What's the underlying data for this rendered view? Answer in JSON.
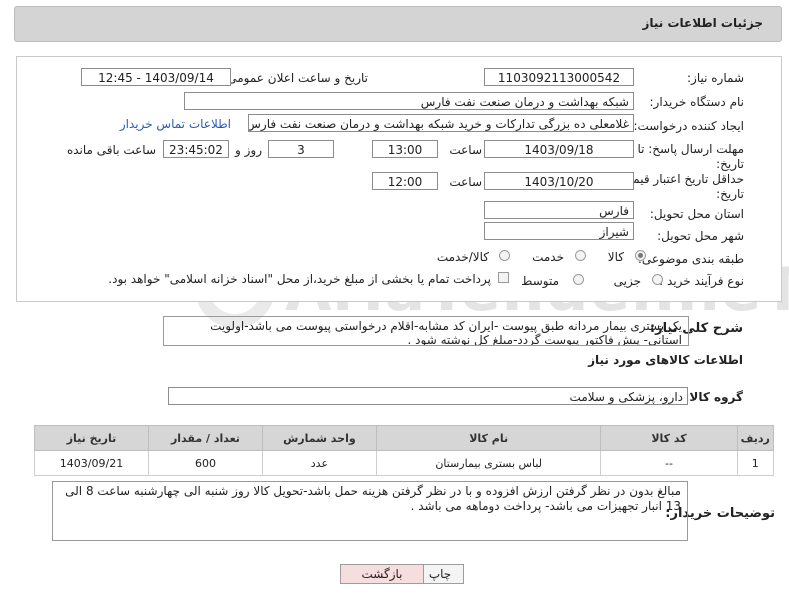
{
  "header": {
    "title": "جزئیات اطلاعات نیاز"
  },
  "form": {
    "need_number": {
      "label": "شماره نیاز:",
      "value": "1103092113000542"
    },
    "announce_datetime": {
      "label": "تاریخ و ساعت اعلان عمومی:",
      "value": "1403/09/14 - 12:45"
    },
    "buyer_org": {
      "label": "نام دستگاه خریدار:",
      "value": "شبکه بهداشت و درمان صنعت نفت فارس"
    },
    "requester": {
      "label": "ایجاد کننده درخواست:",
      "value": "غلامعلی ده بزرگی تدارکات و خرید شبکه بهداشت و درمان صنعت نفت فارس",
      "contact_link": "اطلاعات تماس خریدار"
    },
    "reply_deadline": {
      "label": "مهلت ارسال پاسخ: تا تاریخ:",
      "date": "1403/09/18",
      "time_label": "ساعت",
      "time": "13:00",
      "days": "3",
      "days_label": "روز و",
      "remaining": "23:45:02",
      "remaining_label": "ساعت باقی مانده"
    },
    "price_validity": {
      "label": "حداقل تاریخ اعتبار قیمت: تا تاریخ:",
      "date": "1403/10/20",
      "time_label": "ساعت",
      "time": "12:00"
    },
    "province": {
      "label": "استان محل تحویل:",
      "value": "فارس"
    },
    "city": {
      "label": "شهر محل تحویل:",
      "value": "شیراز"
    },
    "category": {
      "label": "طبقه بندی موضوعی:",
      "options": [
        "کالا",
        "خدمت",
        "کالا/خدمت"
      ]
    },
    "process_type": {
      "label": "نوع فرآیند خرید :",
      "options": [
        "جزیی",
        "متوسط"
      ],
      "payment_note": "پرداخت تمام یا بخشی از مبلغ خرید،از محل \"اسناد خزانه اسلامی\" خواهد بود."
    }
  },
  "description": {
    "label": "شرح کلی نیاز:",
    "text": "یک بستری بیمار مردانه طبق پیوست -ایران کد مشابه-اقلام درخواستی پیوست می باشد-اولویت استانی- پیش فاکتور پیوست گردد-مبلغ کل نوشته شود ."
  },
  "goods_section": {
    "title": "اطلاعات کالاهای مورد نیاز",
    "group_label": "گروه کالا:",
    "group_value": "دارو، پزشکی و سلامت"
  },
  "table": {
    "headers": [
      "ردیف",
      "کد کالا",
      "نام کالا",
      "واحد شمارش",
      "تعداد / مقدار",
      "تاریخ نیاز"
    ],
    "rows": [
      [
        "1",
        "--",
        "لباس بستری بیمارستان",
        "عدد",
        "600",
        "1403/09/21"
      ]
    ]
  },
  "buyer_notes": {
    "label": "توضیحات خریدار:",
    "text": "مبالغ بدون در نظر گرفتن ارزش افزوده و با در نظر گرفتن هزینه حمل باشد-تحویل کالا روز شنبه الی چهارشنبه ساعت 8 الی 13 انبار تجهیزات می باشد- پرداخت دوماهه می باشد ."
  },
  "buttons": {
    "print": "چاپ",
    "back": "بازگشت"
  },
  "watermark": "AriaTender.neT",
  "colors": {
    "link": "#2a5db0",
    "header_bg": "#d4d4d4",
    "back_button_bg": "#f6dede"
  }
}
